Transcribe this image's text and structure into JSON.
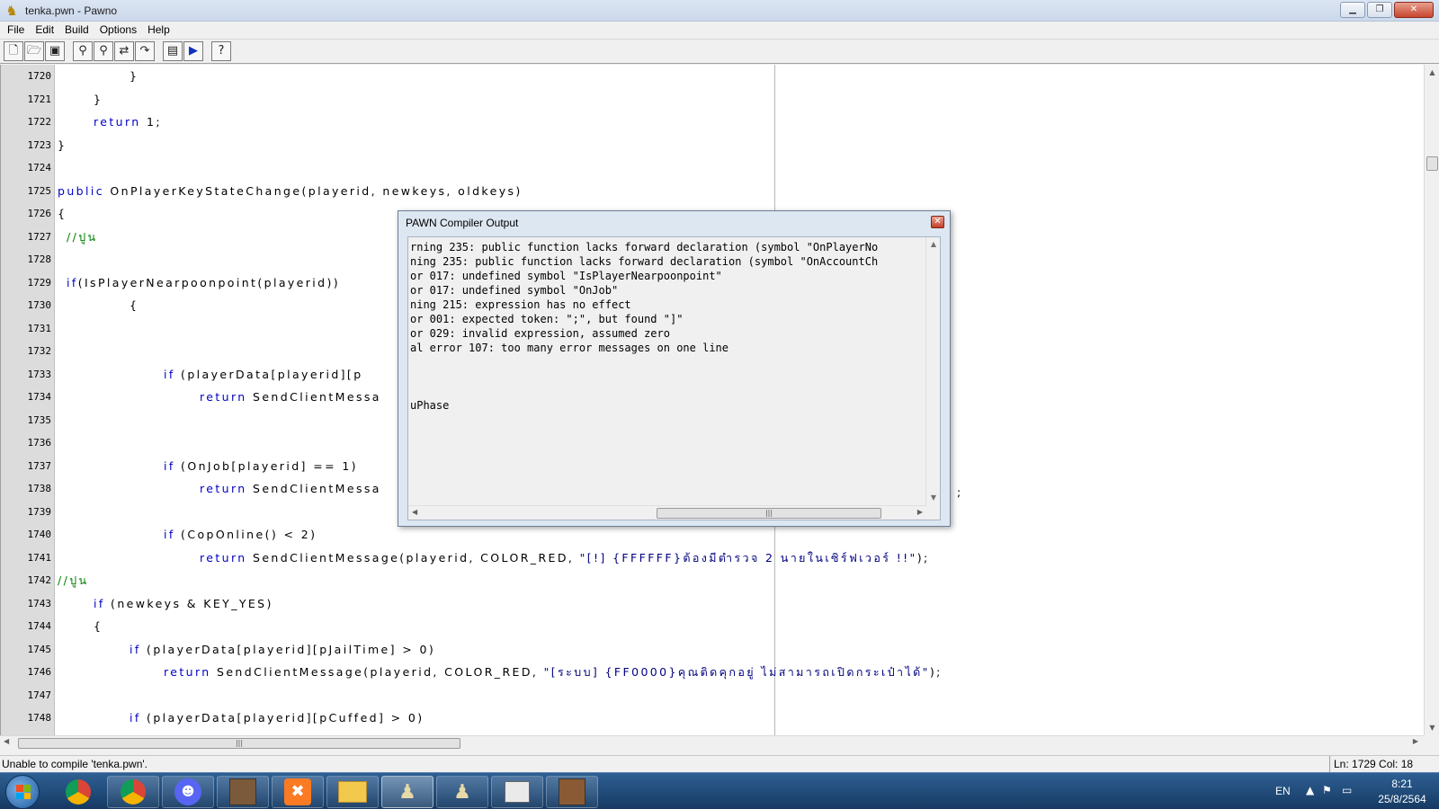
{
  "window": {
    "title": "tenka.pwn - Pawno"
  },
  "menu": [
    "File",
    "Edit",
    "Build",
    "Options",
    "Help"
  ],
  "toolbar_icons": [
    "new-file-icon",
    "open-folder-icon",
    "save-icon",
    "find-icon",
    "find-next-icon",
    "replace-icon",
    "goto-icon",
    "compile-icon",
    "run-icon",
    "help-icon"
  ],
  "editor": {
    "lines": [
      {
        "n": "1720",
        "indent": 80,
        "parts": [
          {
            "t": "}"
          }
        ]
      },
      {
        "n": "1721",
        "indent": 40,
        "parts": [
          {
            "t": "}"
          }
        ]
      },
      {
        "n": "1722",
        "indent": 40,
        "parts": [
          {
            "t": "return",
            "c": "kw"
          },
          {
            "t": " 1;"
          }
        ]
      },
      {
        "n": "1723",
        "indent": 0,
        "parts": [
          {
            "t": "}"
          }
        ]
      },
      {
        "n": "1724",
        "indent": 0,
        "parts": []
      },
      {
        "n": "1725",
        "indent": 0,
        "parts": [
          {
            "t": "public",
            "c": "kw"
          },
          {
            "t": " OnPlayerKeyStateChange(playerid, newkeys, oldkeys)"
          }
        ]
      },
      {
        "n": "1726",
        "indent": 0,
        "parts": [
          {
            "t": "{"
          }
        ]
      },
      {
        "n": "1727",
        "indent": 10,
        "parts": [
          {
            "t": "//ปูน",
            "c": "cm"
          }
        ]
      },
      {
        "n": "1728",
        "indent": 0,
        "parts": []
      },
      {
        "n": "1729",
        "indent": 10,
        "parts": [
          {
            "t": "if",
            "c": "kw"
          },
          {
            "t": "(IsPlayerNearpoonpoint(playerid))"
          }
        ]
      },
      {
        "n": "1730",
        "indent": 80,
        "parts": [
          {
            "t": "{"
          }
        ]
      },
      {
        "n": "1731",
        "indent": 0,
        "parts": []
      },
      {
        "n": "1732",
        "indent": 0,
        "parts": []
      },
      {
        "n": "1733",
        "indent": 118,
        "parts": [
          {
            "t": "if",
            "c": "kw"
          },
          {
            "t": " (playerData[playerid][p"
          }
        ]
      },
      {
        "n": "1734",
        "indent": 158,
        "parts": [
          {
            "t": "return",
            "c": "kw"
          },
          {
            "t": " SendClientMessa"
          }
        ]
      },
      {
        "n": "1735",
        "indent": 0,
        "parts": []
      },
      {
        "n": "1736",
        "indent": 0,
        "parts": []
      },
      {
        "n": "1737",
        "indent": 118,
        "parts": [
          {
            "t": "if",
            "c": "kw"
          },
          {
            "t": " (OnJob[playerid] == 1)"
          }
        ]
      },
      {
        "n": "1738",
        "indent": 158,
        "parts": [
          {
            "t": "return",
            "c": "kw"
          },
          {
            "t": " SendClientMessa"
          }
        ]
      },
      {
        "n": "1739",
        "indent": 0,
        "parts": []
      },
      {
        "n": "1740",
        "indent": 118,
        "parts": [
          {
            "t": "if",
            "c": "kw"
          },
          {
            "t": " (CopOnline() < 2)"
          }
        ]
      },
      {
        "n": "1741",
        "indent": 158,
        "parts": [
          {
            "t": "return",
            "c": "kw"
          },
          {
            "t": " SendClientMessage(playerid, COLOR_RED, "
          },
          {
            "t": "\"[!] {FFFFFF}ต้องมีตำรวจ 2 นายในเซิร์ฟเวอร์ !!\"",
            "c": "str"
          },
          {
            "t": ");"
          }
        ]
      },
      {
        "n": "1742",
        "indent": 0,
        "parts": [
          {
            "t": "//ปูน",
            "c": "cm"
          }
        ]
      },
      {
        "n": "1743",
        "indent": 40,
        "parts": [
          {
            "t": "if",
            "c": "kw"
          },
          {
            "t": " (newkeys & KEY_YES)"
          }
        ]
      },
      {
        "n": "1744",
        "indent": 40,
        "parts": [
          {
            "t": "{"
          }
        ]
      },
      {
        "n": "1745",
        "indent": 80,
        "parts": [
          {
            "t": "if",
            "c": "kw"
          },
          {
            "t": " (playerData[playerid][pJailTime] > 0)"
          }
        ]
      },
      {
        "n": "1746",
        "indent": 118,
        "parts": [
          {
            "t": "return",
            "c": "kw"
          },
          {
            "t": " SendClientMessage(playerid, COLOR_RED, "
          },
          {
            "t": "\"[ระบบ] {FF0000}คุณติดคุกอยู่ ไม่สามารถเปิดกระเป๋าได้\"",
            "c": "str"
          },
          {
            "t": ");"
          }
        ]
      },
      {
        "n": "1747",
        "indent": 0,
        "parts": []
      },
      {
        "n": "1748",
        "indent": 80,
        "parts": [
          {
            "t": "if",
            "c": "kw"
          },
          {
            "t": " (playerData[playerid][pCuffed] > 0)"
          }
        ]
      }
    ],
    "stray_text_1738": ";"
  },
  "dialog": {
    "title": "PAWN Compiler Output",
    "lines": [
      "rning 235: public function lacks forward declaration (symbol \"OnPlayerNo",
      "ning 235: public function lacks forward declaration (symbol \"OnAccountCh",
      "or 017: undefined symbol \"IsPlayerNearpoonpoint\"",
      "or 017: undefined symbol \"OnJob\"",
      "ning 215: expression has no effect",
      "or 001: expected token: \";\", but found \"]\"",
      "or 029: invalid expression, assumed zero",
      "al error 107: too many error messages on one line",
      "",
      "",
      "",
      "uPhase"
    ]
  },
  "status": {
    "message": "Unable to compile 'tenka.pwn'.",
    "position": "Ln: 1729   Col: 18"
  },
  "taskbar": {
    "language": "EN",
    "time": "8:21",
    "date": "25/8/2564"
  },
  "colors": {
    "keyword": "#0000c8",
    "comment": "#008000",
    "string": "#000080"
  }
}
